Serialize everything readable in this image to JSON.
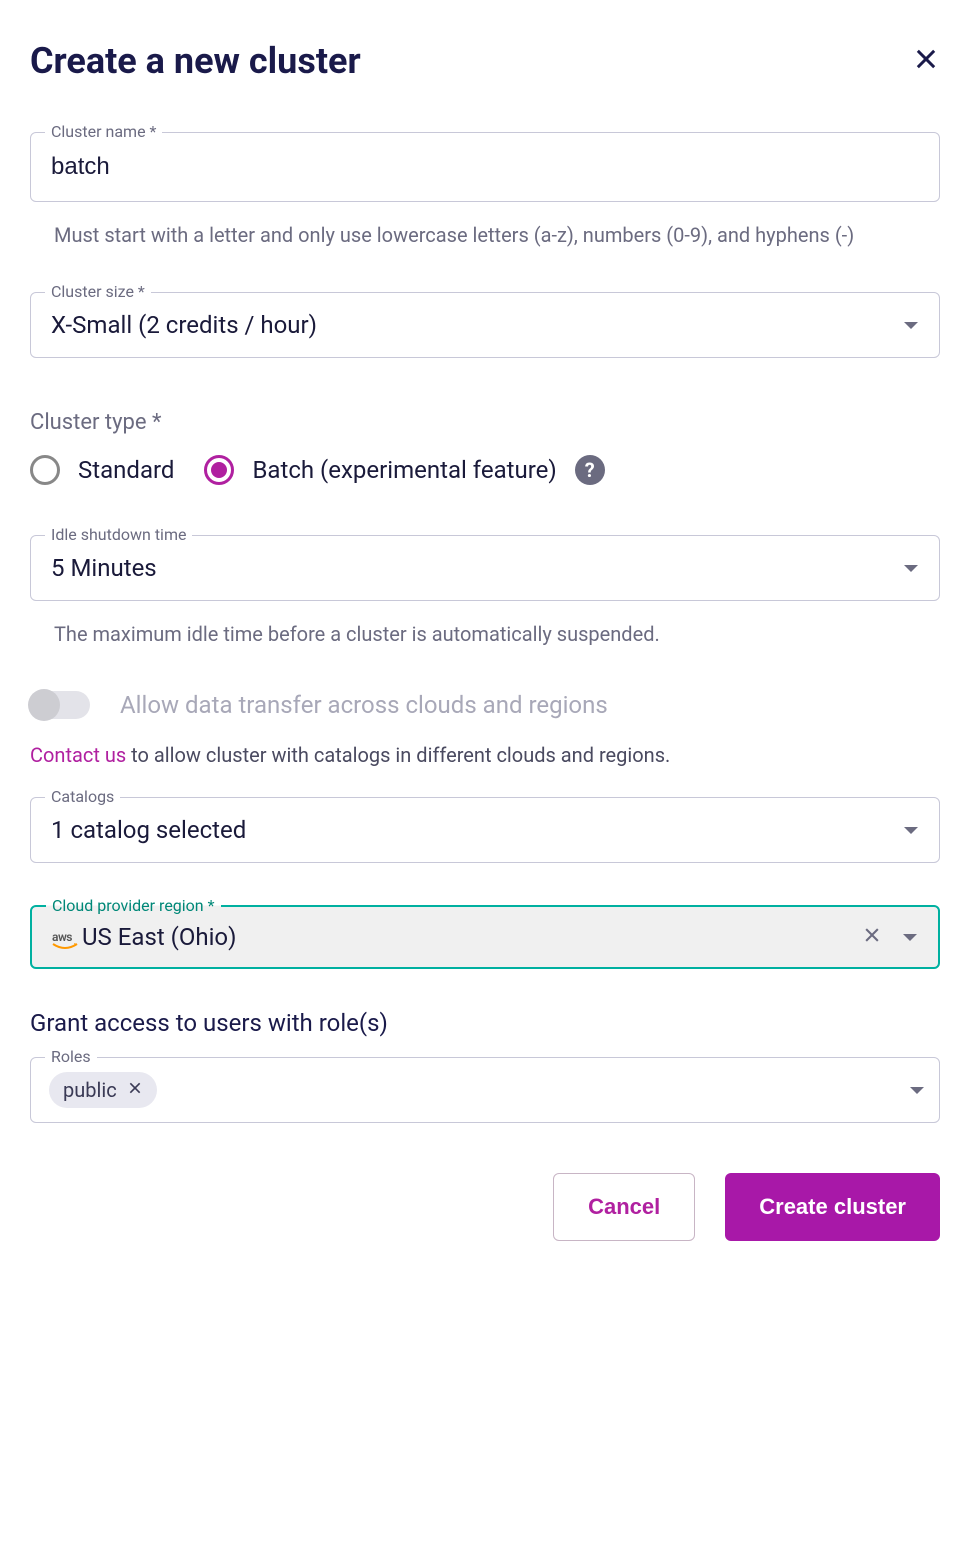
{
  "header": {
    "title": "Create a new cluster"
  },
  "cluster_name": {
    "label": "Cluster name *",
    "value": "batch",
    "helper": "Must start with a letter and only use lowercase letters (a-z), numbers (0-9), and hyphens (-)"
  },
  "cluster_size": {
    "label": "Cluster size *",
    "value": "X-Small (2 credits / hour)"
  },
  "cluster_type": {
    "label": "Cluster type *",
    "options": {
      "standard": "Standard",
      "batch": "Batch (experimental feature)"
    },
    "selected": "batch"
  },
  "idle_shutdown": {
    "label": "Idle shutdown time",
    "value": "5 Minutes",
    "helper": "The maximum idle time before a cluster is automatically suspended."
  },
  "cross_region": {
    "label": "Allow data transfer across clouds and regions",
    "contact_link": "Contact us",
    "contact_rest": " to allow cluster with catalogs in different clouds and regions."
  },
  "catalogs": {
    "label": "Catalogs",
    "value": "1 catalog selected"
  },
  "region": {
    "label": "Cloud provider region *",
    "provider": "aws",
    "value": "US East (Ohio)"
  },
  "grant": {
    "heading": "Grant access to users with role(s)",
    "label": "Roles",
    "chips": [
      "public"
    ]
  },
  "footer": {
    "cancel": "Cancel",
    "create": "Create cluster"
  }
}
